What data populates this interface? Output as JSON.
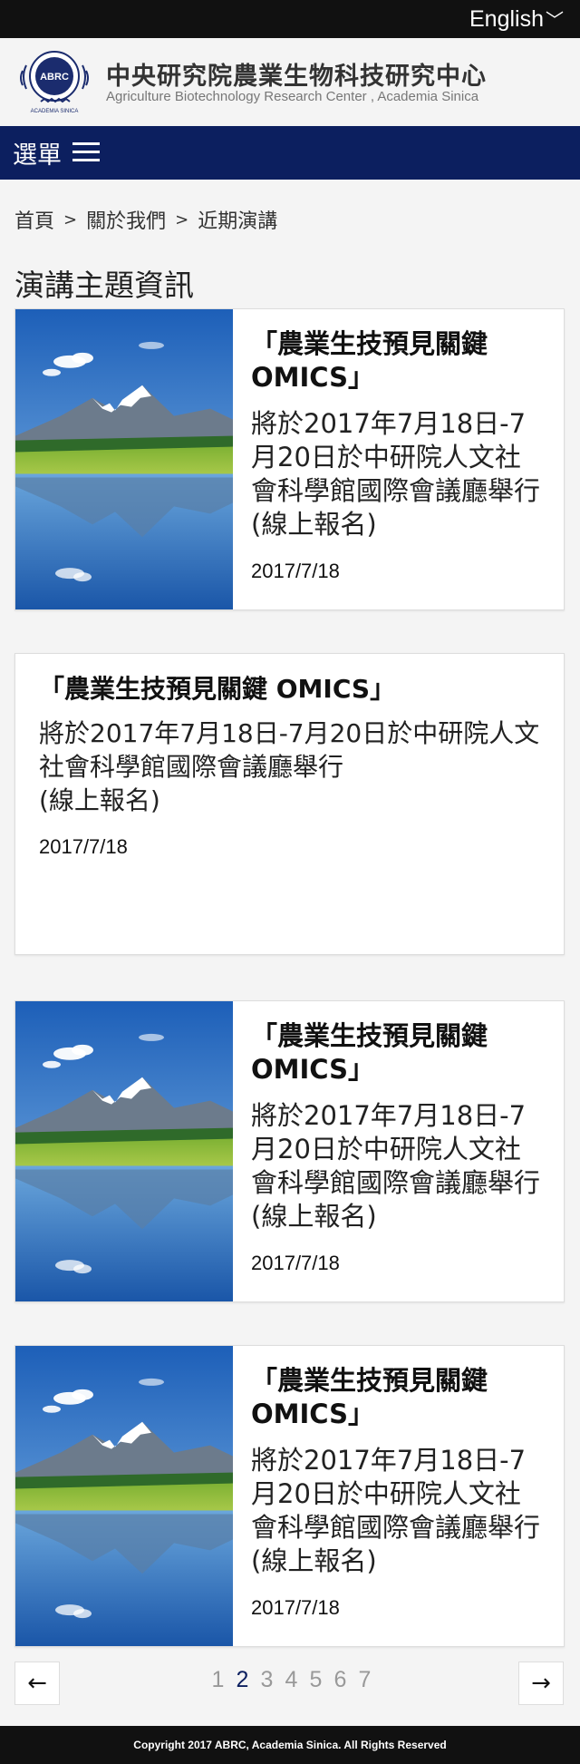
{
  "topbar": {
    "language_label": "English",
    "language_chevron": "﹀"
  },
  "header": {
    "logo_text": "ABRC",
    "logo_sub": "ACADEMIA SINICA",
    "org_name_cn": "中央研究院農業生物科技研究中心",
    "org_name_en": "Agriculture Biotechnology Research Center , Academia Sinica"
  },
  "nav": {
    "menu_label": "選單",
    "menu_icon": "hamburger-icon"
  },
  "breadcrumb": {
    "items": [
      "首頁",
      "關於我們",
      "近期演講"
    ],
    "separator": ">"
  },
  "page_title": "演講主題資訊",
  "cards": [
    {
      "has_image": true,
      "title": "「農業生技預見關鍵 OMICS」",
      "description": "將於2017年7月18日-7月20日於中研院人文社會科學館國際會議廳舉行(線上報名)",
      "date": "2017/7/18"
    },
    {
      "has_image": false,
      "title": "「農業生技預見關鍵 OMICS」",
      "description": "將於2017年7月18日-7月20日於中研院人文社會科學館國際會議廳舉行",
      "description_extra": "(線上報名)",
      "date": "2017/7/18"
    },
    {
      "has_image": true,
      "title": "「農業生技預見關鍵 OMICS」",
      "description": "將於2017年7月18日-7月20日於中研院人文社會科學館國際會議廳舉行(線上報名)",
      "date": "2017/7/18"
    },
    {
      "has_image": true,
      "title": "「農業生技預見關鍵 OMICS」",
      "description": "將於2017年7月18日-7月20日於中研院人文社會科學館國際會議廳舉行(線上報名)",
      "date": "2017/7/18"
    }
  ],
  "pagination": {
    "prev_icon": "←",
    "next_icon": "→",
    "pages": [
      "1",
      "2",
      "3",
      "4",
      "5",
      "6",
      "7"
    ],
    "active_page": "2"
  },
  "footer": {
    "copyright": "Copyright 2017 ABRC, Academia Sinica. All Rights Reserved"
  },
  "colors": {
    "nav_bg": "#0c1f5f",
    "topbar_bg": "#111111",
    "active_page": "#0c1f5f"
  }
}
